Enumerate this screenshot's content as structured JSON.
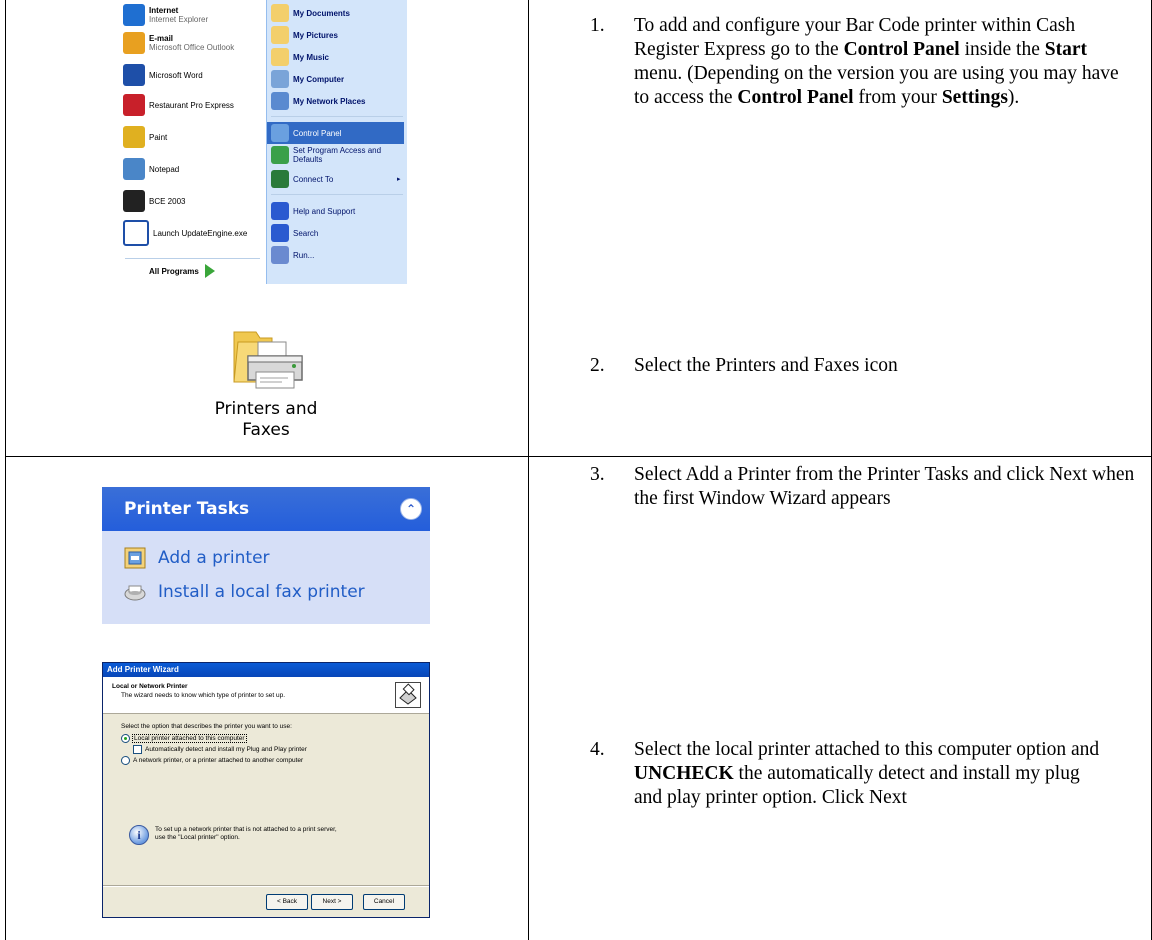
{
  "steps": [
    {
      "number": "1.",
      "parts": [
        {
          "text": "To add and configure your Bar Code printer within Cash Register Express go to the ",
          "bold": false
        },
        {
          "text": "Control Panel",
          "bold": true
        },
        {
          "text": " inside the ",
          "bold": false
        },
        {
          "text": "Start",
          "bold": true
        },
        {
          "text": " menu. (Depending on the version you are using you may have to access the ",
          "bold": false
        },
        {
          "text": "Control Panel",
          "bold": true
        },
        {
          "text": " from your ",
          "bold": false
        },
        {
          "text": "Settings",
          "bold": true
        },
        {
          "text": ").",
          "bold": false
        }
      ]
    },
    {
      "number": "2.",
      "parts": [
        {
          "text": "Select the Printers and Faxes icon",
          "bold": false
        }
      ]
    },
    {
      "number": "3.",
      "parts": [
        {
          "text": "Select Add a Printer from the Printer Tasks and click Next when the first Window Wizard appears",
          "bold": false
        }
      ]
    },
    {
      "number": "4.",
      "parts": [
        {
          "text": "Select the local printer attached to this computer option and ",
          "bold": false
        },
        {
          "text": "UNCHECK",
          "bold": true
        },
        {
          "text": " the automatically detect and install my plug and play printer option.  Click Next",
          "bold": false
        }
      ]
    }
  ],
  "start_menu": {
    "left_items": [
      {
        "main": "Internet",
        "sub": "Internet Explorer",
        "icon": "internet-explorer-icon",
        "color": "#1f6fd1"
      },
      {
        "main": "E-mail",
        "sub": "Microsoft Office Outlook",
        "icon": "outlook-icon",
        "color": "#e8a020"
      },
      {
        "main": "Microsoft Word",
        "sub": "",
        "icon": "word-icon",
        "color": "#1e4fa8"
      },
      {
        "main": "Restaurant Pro Express",
        "sub": "",
        "icon": "restaurant-pro-icon",
        "color": "#c8202a"
      },
      {
        "main": "Paint",
        "sub": "",
        "icon": "paint-icon",
        "color": "#e0b020"
      },
      {
        "main": "Notepad",
        "sub": "",
        "icon": "notepad-icon",
        "color": "#4a86c8"
      },
      {
        "main": "BCE 2003",
        "sub": "",
        "icon": "barcode-icon",
        "color": "#222222"
      },
      {
        "main": "Launch UpdateEngine.exe",
        "sub": "",
        "icon": "window-icon",
        "color": "#ffffff"
      }
    ],
    "all_programs": "All Programs",
    "right_items": [
      {
        "label": "My Documents",
        "bold": true,
        "icon": "folder-icon",
        "color": "#f3cf6b"
      },
      {
        "label": "My Pictures",
        "bold": true,
        "icon": "folder-icon",
        "color": "#f3cf6b"
      },
      {
        "label": "My Music",
        "bold": true,
        "icon": "folder-icon",
        "color": "#f3cf6b"
      },
      {
        "label": "My Computer",
        "bold": true,
        "icon": "computer-icon",
        "color": "#7aa4d8"
      },
      {
        "label": "My Network Places",
        "bold": true,
        "icon": "network-icon",
        "color": "#5a8ad0"
      },
      {
        "label": "Control Panel",
        "bold": false,
        "icon": "control-panel-icon",
        "color": "#6aa0e0"
      },
      {
        "label": "Set Program Access and Defaults",
        "bold": false,
        "icon": "program-access-icon",
        "color": "#3aa04a"
      },
      {
        "label": "Connect To",
        "bold": false,
        "icon": "connect-icon",
        "color": "#2a7a3a"
      },
      {
        "label": "Help and Support",
        "bold": false,
        "icon": "help-icon",
        "color": "#2a5ad0"
      },
      {
        "label": "Search",
        "bold": false,
        "icon": "search-icon",
        "color": "#2a5ad0"
      },
      {
        "label": "Run...",
        "bold": false,
        "icon": "run-icon",
        "color": "#6a8ad0"
      }
    ]
  },
  "printers_and_faxes": {
    "label_line1": "Printers and",
    "label_line2": "Faxes"
  },
  "printer_tasks": {
    "title": "Printer Tasks",
    "items": [
      "Add a printer",
      "Install a local fax printer"
    ]
  },
  "wizard": {
    "title": "Add Printer Wizard",
    "heading": "Local or Network Printer",
    "subheading": "The wizard needs to know which type of printer to set up.",
    "prompt": "Select the option that describes the printer you want to use:",
    "option_local": "Local printer attached to this computer",
    "option_auto": "Automatically detect and install my Plug and Play printer",
    "option_network": "A network printer, or a printer attached to another computer",
    "info_line1": "To set up a network printer that is not attached to a print server,",
    "info_line2": "use the \"Local printer\" option.",
    "btn_back": "< Back",
    "btn_next": "Next >",
    "btn_cancel": "Cancel"
  }
}
